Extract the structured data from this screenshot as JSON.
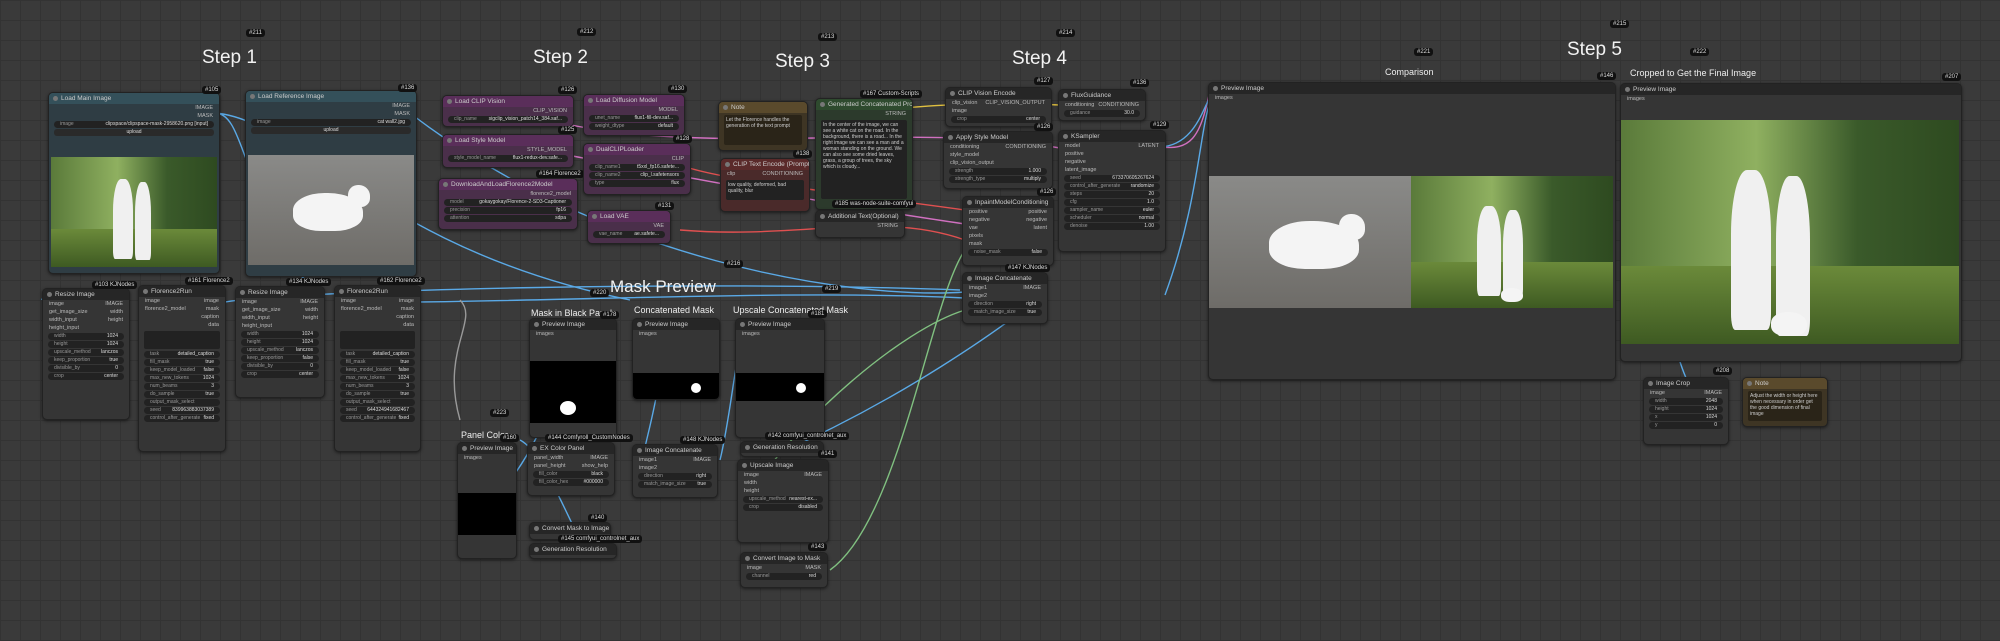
{
  "steps": {
    "s1": "Step 1",
    "s2": "Step 2",
    "s3": "Step 3",
    "s4": "Step 4",
    "s5": "Step 5"
  },
  "sections": {
    "mask_preview": "Mask Preview",
    "comparison": "Comparison",
    "cropped": "Cropped to Get the Final Image",
    "mask_black": "Mask in Black Panel",
    "concat_mask": "Concatenated Mask",
    "upscale_concat": "Upscale Concatenated Mask",
    "panel_color": "Panel Color"
  },
  "badges": {
    "b211": "#211",
    "b212": "#212",
    "b213": "#213",
    "b214": "#214",
    "b215": "#215",
    "b221": "#221",
    "b222": "#222",
    "b223": "#223",
    "b220": "#220",
    "b219": "#219",
    "b216": "#216"
  },
  "nodes": {
    "load_main": {
      "title": "Load Main Image",
      "id": "#105",
      "out1": "IMAGE",
      "out2": "MASK",
      "image": "image",
      "file": "clipspace/clipspace-mask-2958620.png [input]",
      "upload": "upload"
    },
    "load_ref": {
      "title": "Load Reference Image",
      "id": "#136",
      "out1": "IMAGE",
      "out2": "MASK",
      "image": "image",
      "file": "cat wall2.jpg",
      "upload": "upload"
    },
    "resize1": {
      "title": "Resize Image",
      "id": "#103 KJNodes",
      "in1": "image",
      "in2": "get_image_size",
      "in3": "width_input",
      "in4": "height_input",
      "out1": "IMAGE",
      "out2": "width",
      "out3": "height",
      "w_k": "width",
      "w_v": "1024",
      "h_k": "height",
      "h_v": "1024",
      "up_k": "upscale_method",
      "up_v": "lanczos",
      "kp_k": "keep_proportion",
      "kp_v": "true",
      "div_k": "divisible_by",
      "div_v": "0",
      "crop_k": "crop",
      "crop_v": "center"
    },
    "florence1": {
      "title": "Florence2Run",
      "id": "#161 Florence2",
      "in1": "image",
      "in2": "florence2_model",
      "out1": "image",
      "out2": "mask",
      "out3": "caption",
      "out4": "data",
      "task_k": "task",
      "task_v": "detailed_caption",
      "fm_k": "fill_mask",
      "fm_v": "true",
      "kb_k": "keep_model_loaded",
      "kb_v": "false",
      "mt_k": "max_new_tokens",
      "mt_v": "1024",
      "nb_k": "num_beams",
      "nb_v": "3",
      "ds_k": "do_sample",
      "ds_v": "true",
      "om_k": "output_mask_select",
      "om_v": "",
      "seed_k": "seed",
      "seed_v": "839963883037389",
      "ca_k": "control_after_generate",
      "ca_v": "fixed"
    },
    "resize2": {
      "title": "Resize Image",
      "id": "#134 KJNodes",
      "w_v": "1024",
      "h_v": "1024",
      "up_v": "lanczos",
      "kp_v": "false",
      "div_v": "0",
      "crop_v": "center"
    },
    "florence2": {
      "title": "Florence2Run",
      "id": "#162 Florence2",
      "task_v": "detailed_caption",
      "fm_v": "true",
      "kb_v": "false",
      "mt_v": "1024",
      "nb_v": "3",
      "ds_v": "true",
      "seed_v": "644324941682467",
      "ca_v": "fixed"
    },
    "clip_vision": {
      "title": "Load CLIP Vision",
      "id": "#126",
      "out": "CLIP_VISION",
      "k": "clip_name",
      "v": "sigclip_vision_patch14_384.saf..."
    },
    "style_model": {
      "title": "Load Style Model",
      "id": "#125",
      "out": "STYLE_MODEL",
      "k": "style_model_name",
      "v": "flux1-redux-dev.safe..."
    },
    "download_florence": {
      "title": "DownloadAndLoadFlorence2Model",
      "id": "#164 Florence2",
      "out": "florence2_model",
      "m_k": "model",
      "m_v": "gokaygokay/Florence-2-SD3-Captioner",
      "p_k": "precision",
      "p_v": "fp16",
      "a_k": "attention",
      "a_v": "sdpa"
    },
    "diffusion": {
      "title": "Load Diffusion Model",
      "id": "#130",
      "out": "MODEL",
      "k1": "unet_name",
      "v1": "flux1-fill-dev.saf...",
      "k2": "weight_dtype",
      "v2": "default"
    },
    "dualclip": {
      "title": "DualCLIPLoader",
      "id": "#128",
      "out": "CLIP",
      "k1": "clip_name1",
      "v1": "t5xxl_fp16.safete...",
      "k2": "clip_name2",
      "v2": "clip_l.safetensors",
      "k3": "type",
      "v3": "flux"
    },
    "vae": {
      "title": "Load VAE",
      "id": "#131",
      "out": "VAE",
      "k": "vae_name",
      "v": "ae.safete..."
    },
    "note1": {
      "title": "Note",
      "text": "Let the Florence handles the generation of the text prompt"
    },
    "gen_concat": {
      "title": "Generated Concatenated Prompt",
      "id": "#167 Custom-Scripts",
      "out": "STRING",
      "text": "In the center of the image, we can see a white cat on the road. In the background, there is a road... In the right image we can see a man and a woman standing on the ground. We can also see some dried leaves, grass, a group of trees, the sky which is cloudy..."
    },
    "clip_text": {
      "title": "CLIP Text Encode (Prompt)",
      "id": "#138",
      "in": "clip",
      "out": "CONDITIONING",
      "text": "low quality, deformed, bad quality, blur"
    },
    "custom_combo": {
      "title": "#185 was-node-suite-comfyui"
    },
    "additional_text": {
      "title": "Additional Text(Optional)",
      "out": "STRING"
    },
    "clip_vision_enc": {
      "title": "CLIP Vision Encode",
      "id": "#127",
      "in1": "clip_vision",
      "in2": "image",
      "out": "CLIP_VISION_OUTPUT",
      "k": "crop",
      "v": "center"
    },
    "apply_style": {
      "title": "Apply Style Model",
      "id": "#126",
      "in1": "conditioning",
      "in2": "style_model",
      "in3": "clip_vision_output",
      "out": "CONDITIONING",
      "k1": "strength",
      "v1": "1.000",
      "k2": "strength_type",
      "v2": "multiply"
    },
    "flux_guidance": {
      "title": "FluxGuidance",
      "id": "#136",
      "in": "conditioning",
      "out": "CONDITIONING",
      "k": "guidance",
      "v": "30.0"
    },
    "ksampler": {
      "title": "KSampler",
      "id": "#129",
      "in1": "model",
      "in2": "positive",
      "in3": "negative",
      "in4": "latent_image",
      "out": "LATENT",
      "seed_k": "seed",
      "seed_v": "673370605267624",
      "ca_k": "control_after_generate",
      "ca_v": "randomize",
      "steps_k": "steps",
      "steps_v": "20",
      "cfg_k": "cfg",
      "cfg_v": "1.0",
      "sn_k": "sampler_name",
      "sn_v": "euler",
      "sc_k": "scheduler",
      "sc_v": "normal",
      "dn_k": "denoise",
      "dn_v": "1.00"
    },
    "inpaint_cond": {
      "title": "InpaintModelConditioning",
      "id": "#126",
      "in1": "positive",
      "in2": "negative",
      "in3": "vae",
      "in4": "pixels",
      "in5": "mask",
      "out1": "positive",
      "out2": "negative",
      "out3": "latent",
      "k": "noise_mask",
      "v": "false"
    },
    "img_concat_top": {
      "title": "Image Concatenate",
      "id": "#147 KJNodes",
      "in1": "image1",
      "in2": "image2",
      "out": "IMAGE",
      "k1": "direction",
      "v1": "right",
      "k2": "match_image_size",
      "v2": "true"
    },
    "preview_cmp": {
      "title": "Preview Image",
      "id": "#146",
      "in": "images"
    },
    "preview_final": {
      "title": "Preview Image",
      "id": "#207",
      "in": "images"
    },
    "image_crop": {
      "title": "Image Crop",
      "id": "#208",
      "in": "image",
      "out": "IMAGE",
      "k1": "width",
      "v1": "2048",
      "k2": "height",
      "v2": "1024",
      "k3": "x",
      "v3": "1024",
      "k4": "y",
      "v4": "0"
    },
    "note2": {
      "title": "Note",
      "text": "Adjust the width or height here when necessary in order get the good dimension of final image"
    },
    "preview_mask1": {
      "title": "Preview Image",
      "in": "images",
      "id": "#178"
    },
    "preview_mask2": {
      "title": "Preview Image",
      "in": "images"
    },
    "preview_mask3": {
      "title": "Preview Image",
      "in": "images",
      "id": "#181"
    },
    "preview_panel": {
      "title": "Preview Image",
      "in": "images",
      "id": "#160"
    },
    "empty_panel": {
      "title": "EX Color Panel",
      "id": "#144 Comfyroll_CustomNodes",
      "in1": "panel_width",
      "in2": "panel_height",
      "out1": "IMAGE",
      "out2": "show_help",
      "k1": "fill_color",
      "v1": "black",
      "k2": "fill_color_hex",
      "v2": "#000000"
    },
    "convert_mask1": {
      "title": "Convert Mask to Image",
      "id": "#140"
    },
    "gen_res1": {
      "title": "Generation Resolution",
      "id": "#145 comfyui_controlnet_aux"
    },
    "img_concat_mid": {
      "title": "Image Concatenate",
      "id": "#148 KJNodes",
      "in1": "image1",
      "in2": "image2",
      "out": "IMAGE",
      "k1": "direction",
      "v1": "right",
      "k2": "match_image_size",
      "v2": "true"
    },
    "gen_res2": {
      "title": "Generation Resolution",
      "id": "#142 comfyui_controlnet_aux"
    },
    "upscale_image": {
      "title": "Upscale Image",
      "id": "#141",
      "in1": "image",
      "in2": "width",
      "in3": "height",
      "out": "IMAGE",
      "k1": "upscale_method",
      "v1": "nearest-ex...",
      "k2": "crop",
      "v2": "disabled"
    },
    "convert_img_mask": {
      "title": "Convert Image to Mask",
      "id": "#143",
      "in": "image",
      "out": "MASK",
      "k": "channel",
      "v": "red"
    }
  },
  "colors": {
    "wire_blue": "#5aa9e6",
    "wire_red": "#e05050",
    "wire_yellow": "#e0c040",
    "wire_pink": "#d070c0",
    "wire_green": "#80c080",
    "wire_gray": "#999999"
  }
}
